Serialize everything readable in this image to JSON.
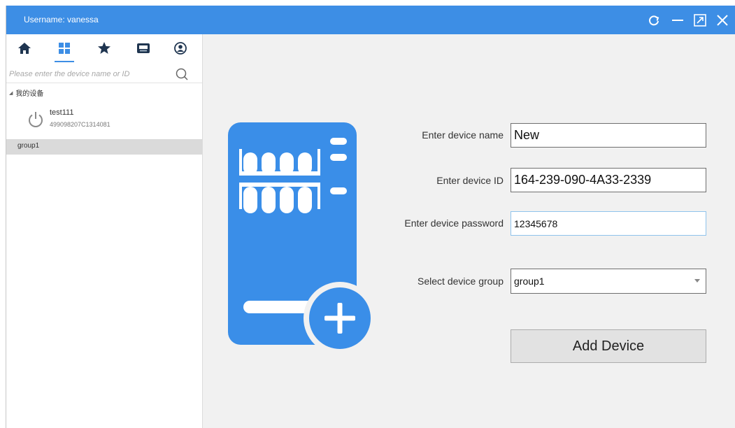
{
  "window": {
    "title": "Username: vanessa",
    "controls": [
      {
        "name": "refresh-icon"
      },
      {
        "name": "minimize-icon"
      },
      {
        "name": "maximize-icon"
      },
      {
        "name": "close-icon"
      }
    ]
  },
  "sidebar": {
    "tabs": [
      {
        "icon": "home-icon",
        "active": false
      },
      {
        "icon": "grid-icon",
        "active": true
      },
      {
        "icon": "star-icon",
        "active": false
      },
      {
        "icon": "camera-icon",
        "active": false
      },
      {
        "icon": "user-icon",
        "active": false
      }
    ],
    "search": {
      "placeholder": "Please enter the device name or ID"
    },
    "tree_root": "我的设备",
    "devices": [
      {
        "name": "test111",
        "id": "499098207C1314081"
      }
    ],
    "groups": [
      "group1"
    ]
  },
  "form": {
    "name_label": "Enter device name",
    "name_value": "New",
    "id_label": "Enter device ID",
    "id_value": "164-239-090-4A33-2339",
    "password_label": "Enter device password",
    "password_value": "12345678",
    "group_label": "Select device group",
    "group_value": "group1",
    "add_label": "Add Device"
  },
  "colors": {
    "accent": "#3d8ee5",
    "server_icon": "#3a8ee8"
  }
}
